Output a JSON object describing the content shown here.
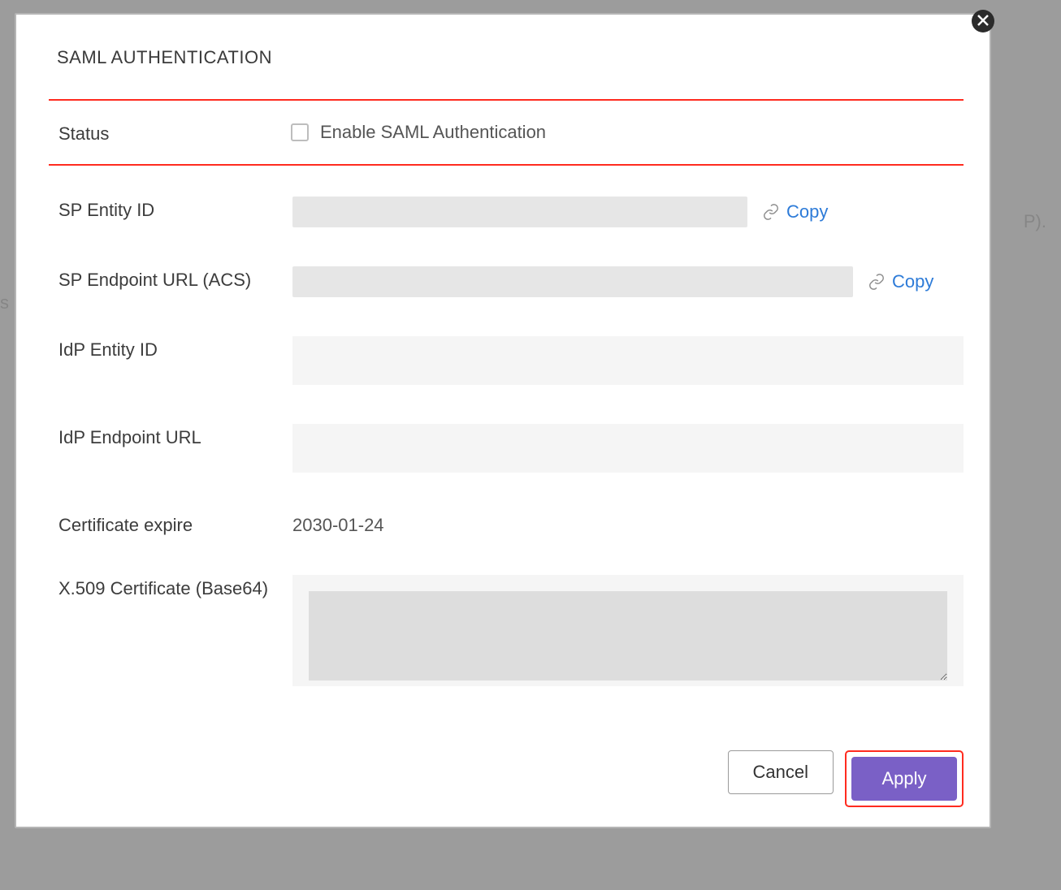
{
  "modal": {
    "title": "SAML AUTHENTICATION",
    "close_icon": "close-icon",
    "status": {
      "label": "Status",
      "checkbox_label": "Enable SAML Authentication",
      "checked": false
    },
    "sp_entity_id": {
      "label": "SP Entity ID",
      "value": "",
      "copy_label": "Copy"
    },
    "sp_endpoint": {
      "label": "SP Endpoint URL (ACS)",
      "value": "",
      "copy_label": "Copy"
    },
    "idp_entity_id": {
      "label": "IdP Entity ID",
      "value": ""
    },
    "idp_endpoint": {
      "label": "IdP Endpoint URL",
      "value": ""
    },
    "cert_expire": {
      "label": "Certificate expire",
      "value": "2030-01-24"
    },
    "x509": {
      "label": "X.509 Certificate (Base64)",
      "value": ""
    },
    "buttons": {
      "cancel": "Cancel",
      "apply": "Apply"
    }
  }
}
